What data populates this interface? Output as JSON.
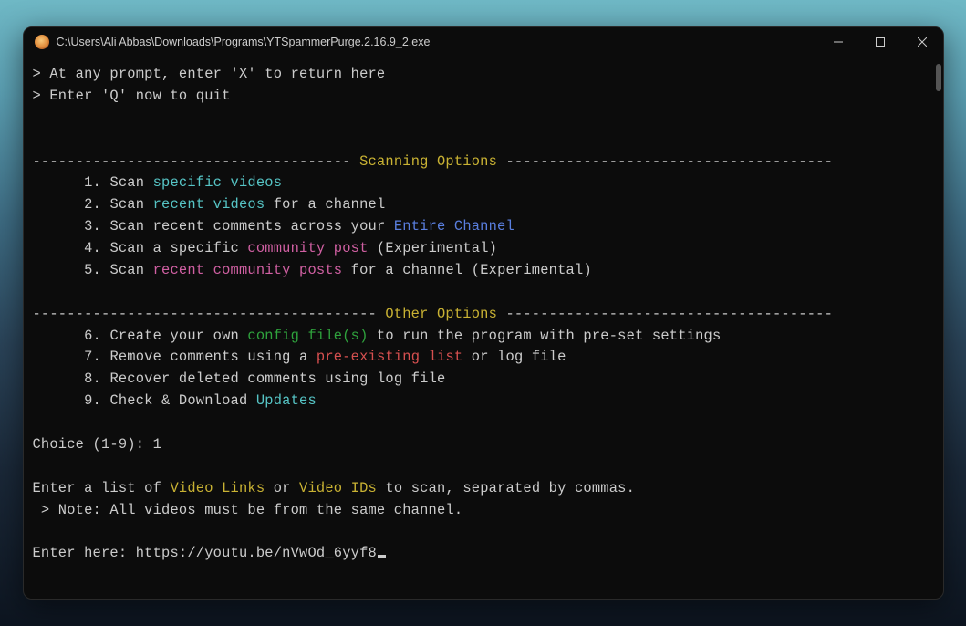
{
  "window": {
    "title": "C:\\Users\\Ali Abbas\\Downloads\\Programs\\YTSpammerPurge.2.16.9_2.exe"
  },
  "header": {
    "hint_return": "> At any prompt, enter 'X' to return here",
    "hint_quit": "> Enter 'Q' now to quit"
  },
  "sections": {
    "scanning_title": " Scanning Options ",
    "other_title": " Other Options ",
    "rule_left": "-------------------------------------",
    "rule_right_scan": "--------------------------------------",
    "rule_left_other": "----------------------------------------",
    "rule_right_other": "--------------------------------------"
  },
  "options": {
    "o1": {
      "num": "      1. ",
      "p1": "Scan ",
      "hl": "specific videos"
    },
    "o2": {
      "num": "      2. ",
      "p1": "Scan ",
      "hl": "recent videos",
      "p2": " for a channel"
    },
    "o3": {
      "num": "      3. ",
      "p1": "Scan recent comments across your ",
      "hl": "Entire Channel"
    },
    "o4": {
      "num": "      4. ",
      "p1": "Scan a specific ",
      "hl": "community post",
      "p2": " (Experimental)"
    },
    "o5": {
      "num": "      5. ",
      "p1": "Scan ",
      "hl": "recent community posts",
      "p2": " for a channel (Experimental)"
    },
    "o6": {
      "num": "      6. ",
      "p1": "Create your own ",
      "hl": "config file(s)",
      "p2": " to run the program with pre-set settings"
    },
    "o7": {
      "num": "      7. ",
      "p1": "Remove comments using a ",
      "hl": "pre-existing list",
      "p2": " or log file"
    },
    "o8": {
      "num": "      8. ",
      "p1": "Recover deleted comments using log file"
    },
    "o9": {
      "num": "      9. ",
      "p1": "Check & Download ",
      "hl": "Updates"
    }
  },
  "prompt": {
    "choice_label": "Choice (1-9): ",
    "choice_value": "1",
    "instr_p1": "Enter a list of ",
    "instr_hl1": "Video Links",
    "instr_p2": " or ",
    "instr_hl2": "Video IDs",
    "instr_p3": " to scan, separated by commas.",
    "note": " > Note: All videos must be from the same channel.",
    "input_label": "Enter here: ",
    "input_value": "https://youtu.be/nVwOd_6yyf8"
  }
}
